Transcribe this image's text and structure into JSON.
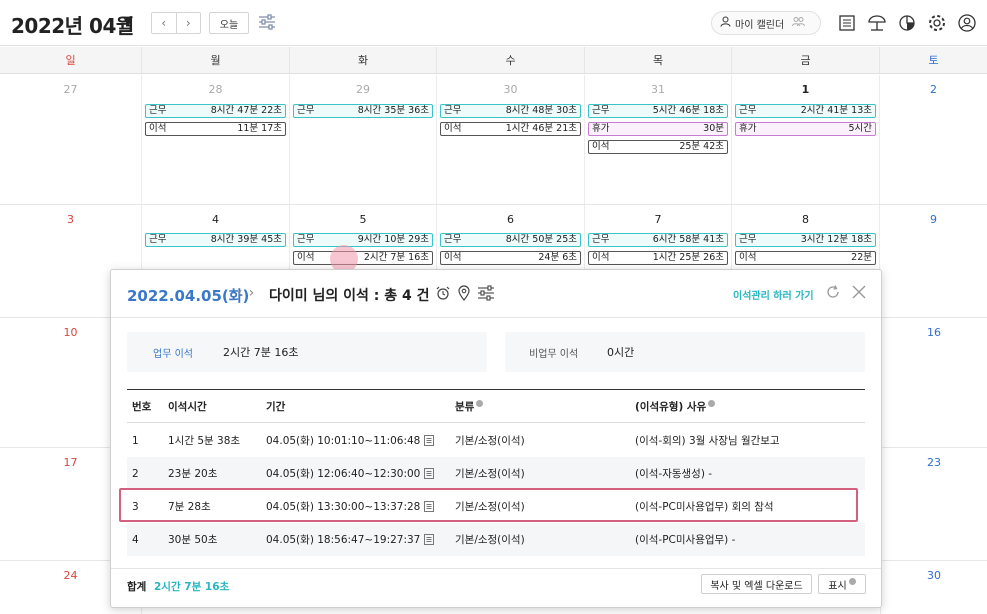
{
  "header": {
    "month_title": "2022년 04월",
    "today_label": "오늘",
    "my_calendar_label": "마이 캘린더"
  },
  "weekdays": [
    "일",
    "월",
    "화",
    "수",
    "목",
    "금",
    "토"
  ],
  "week1": {
    "days": [
      "27",
      "28",
      "29",
      "30",
      "31",
      "1",
      "2"
    ],
    "mon": [
      {
        "type": "근무",
        "time": "8시간 47분 22초"
      },
      {
        "type": "이석",
        "time": "11분 17초"
      }
    ],
    "tue": [
      {
        "type": "근무",
        "time": "8시간 35분 36초"
      }
    ],
    "wed": [
      {
        "type": "근무",
        "time": "8시간 48분 30초"
      },
      {
        "type": "이석",
        "time": "1시간 46분 21초"
      }
    ],
    "thu": [
      {
        "type": "근무",
        "time": "5시간 46분 18초"
      },
      {
        "type": "휴가",
        "time": "30분"
      },
      {
        "type": "이석",
        "time": "25분 42초"
      }
    ],
    "fri": [
      {
        "type": "근무",
        "time": "2시간 41분 13초"
      },
      {
        "type": "휴가",
        "time": "5시간"
      }
    ]
  },
  "week2": {
    "days": [
      "3",
      "4",
      "5",
      "6",
      "7",
      "8",
      "9"
    ],
    "mon": [
      {
        "type": "근무",
        "time": "8시간 39분 45초"
      }
    ],
    "tue": [
      {
        "type": "근무",
        "time": "9시간 10분 29초"
      },
      {
        "type": "이석",
        "time": "2시간 7분 16초"
      }
    ],
    "wed": [
      {
        "type": "근무",
        "time": "8시간 50분 25초"
      },
      {
        "type": "이석",
        "time": "24분 6초"
      }
    ],
    "thu": [
      {
        "type": "근무",
        "time": "6시간 58분 41초"
      },
      {
        "type": "이석",
        "time": "1시간 25분 26초"
      }
    ],
    "fri": [
      {
        "type": "근무",
        "time": "3시간 12분 18초"
      },
      {
        "type": "이석",
        "time": "22분"
      }
    ]
  },
  "week_rows": {
    "w3_sun": "10",
    "w3_sat": "16",
    "w4_sun": "17",
    "w4_sat": "23",
    "w5_sun": "24",
    "w5_sat": "30"
  },
  "popup": {
    "date": "2022.04.05(화)",
    "title": "다이미 님의 이석 : 총 4 건",
    "link_label": "이석관리 하러 가기",
    "work_away_label": "업무 이석",
    "work_away_value": "2시간 7분 16초",
    "nonwork_away_label": "비업무 이석",
    "nonwork_away_value": "0시간",
    "columns": [
      "번호",
      "이석시간",
      "기간",
      "분류",
      "(이석유형) 사유"
    ],
    "rows": [
      {
        "no": "1",
        "duration": "1시간 5분 38초",
        "period": "04.05(화) 10:01:10~11:06:48",
        "category": "기본/소정(이석)",
        "reason": "(이석-회의) 3월 사장님 월간보고"
      },
      {
        "no": "2",
        "duration": "23분 20초",
        "period": "04.05(화) 12:06:40~12:30:00",
        "category": "기본/소정(이석)",
        "reason": "(이석-자동생성) -"
      },
      {
        "no": "3",
        "duration": "7분 28초",
        "period": "04.05(화) 13:30:00~13:37:28",
        "category": "기본/소정(이석)",
        "reason": "(이석-PC미사용업무) 회의 참석"
      },
      {
        "no": "4",
        "duration": "30분 50초",
        "period": "04.05(화) 18:56:47~19:27:37",
        "category": "기본/소정(이석)",
        "reason": "(이석-PC미사용업무) -"
      }
    ],
    "total_label": "합계",
    "total_value": "2시간 7분 16초",
    "excel_button": "복사 및 엑셀 다운로드",
    "display_button": "표시"
  },
  "colors": {
    "accent_blue": "#3a78c9",
    "accent_teal": "#29b6c0",
    "sunday_red": "#d9453b",
    "saturday_blue": "#2f6fcf",
    "highlight_pink": "#d2607e"
  }
}
